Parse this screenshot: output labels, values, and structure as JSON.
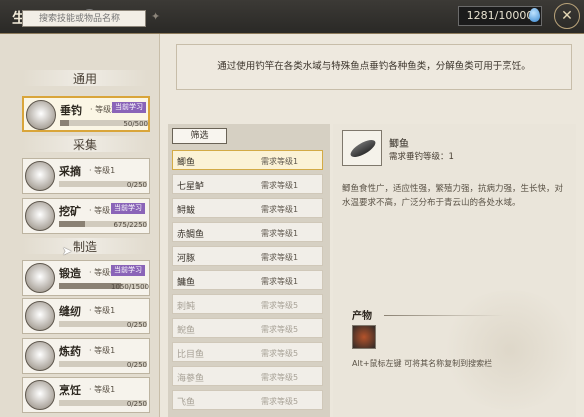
{
  "header": {
    "title": "生产手册",
    "energy": "1281/10000"
  },
  "sidebar": {
    "search_placeholder": "搜索技能或物品名称",
    "sections": [
      {
        "label": "通用"
      },
      {
        "label": "采集"
      },
      {
        "label": "制造"
      }
    ],
    "skills": [
      {
        "name": "垂钓",
        "level": "· 等级2",
        "badge": "当前学习",
        "progress": "50/500",
        "ratio": 0.1,
        "active": true
      },
      {
        "name": "采摘",
        "level": "· 等级1",
        "badge": "",
        "progress": "0/250",
        "ratio": 0
      },
      {
        "name": "挖矿",
        "level": "· 等级12",
        "badge": "当前学习",
        "progress": "675/2250",
        "ratio": 0.3
      },
      {
        "name": "锻造",
        "level": "· 等级6",
        "badge": "当前学习",
        "progress": "1050/1500",
        "ratio": 0.7
      },
      {
        "name": "缝纫",
        "level": "· 等级1",
        "badge": "",
        "progress": "0/250",
        "ratio": 0
      },
      {
        "name": "炼药",
        "level": "· 等级1",
        "badge": "",
        "progress": "0/250",
        "ratio": 0
      },
      {
        "name": "烹饪",
        "level": "· 等级1",
        "badge": "",
        "progress": "0/250",
        "ratio": 0
      }
    ]
  },
  "description": "通过使用钓竿在各类水域与特殊鱼点垂钓各种鱼类，分解鱼类可用于烹饪。",
  "filter_label": "筛选",
  "recipes": [
    {
      "name": "鲫鱼",
      "req": "需求等级1",
      "selected": true
    },
    {
      "name": "七星鲈",
      "req": "需求等级1"
    },
    {
      "name": "鲟鲅",
      "req": "需求等级1"
    },
    {
      "name": "赤鲷鱼",
      "req": "需求等级1"
    },
    {
      "name": "河豚",
      "req": "需求等级1"
    },
    {
      "name": "鳙鱼",
      "req": "需求等级1"
    },
    {
      "name": "刺鲀",
      "req": "需求等级5",
      "dim": true
    },
    {
      "name": "鲵鱼",
      "req": "需求等级5",
      "dim": true
    },
    {
      "name": "比目鱼",
      "req": "需求等级5",
      "dim": true
    },
    {
      "name": "海蔘鱼",
      "req": "需求等级5",
      "dim": true
    },
    {
      "name": "飞鱼",
      "req": "需求等级5",
      "dim": true
    }
  ],
  "detail": {
    "name": "鲫鱼",
    "requirement": "需求垂钓等级：1",
    "description": "鲫鱼食性广，适应性强，繁殖力强，抗病力强，生长快，对水温要求不高，广泛分布于青云山的各处水域。",
    "products_label": "产物",
    "tip": "Alt+鼠标左键 可将其名称复制到搜索栏"
  }
}
